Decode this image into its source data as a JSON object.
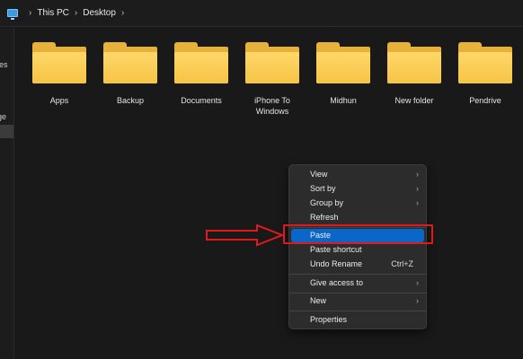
{
  "breadcrumb": {
    "items": [
      "This PC",
      "Desktop"
    ],
    "separator": "›"
  },
  "navpane": {
    "fragments": [
      "les",
      "ge"
    ]
  },
  "folders": [
    {
      "label": "Apps"
    },
    {
      "label": "Backup"
    },
    {
      "label": "Documents"
    },
    {
      "label": "iPhone To Windows"
    },
    {
      "label": "Midhun"
    },
    {
      "label": "New folder"
    },
    {
      "label": "Pendrive"
    }
  ],
  "context_menu": {
    "items": {
      "view": "View",
      "sort_by": "Sort by",
      "group_by": "Group by",
      "refresh": "Refresh",
      "paste": "Paste",
      "paste_shortcut": "Paste shortcut",
      "undo_rename": "Undo Rename",
      "undo_rename_shortcut": "Ctrl+Z",
      "give_access": "Give access to",
      "new": "New",
      "properties": "Properties"
    },
    "chevron": "›"
  },
  "annotation": {
    "highlight_color": "#e01a1a",
    "highlight_target": "paste"
  },
  "colors": {
    "background": "#191919",
    "menu_background": "#2c2c2c",
    "selected_item": "#0a67c9",
    "folder_yellow": "#f6c445"
  }
}
